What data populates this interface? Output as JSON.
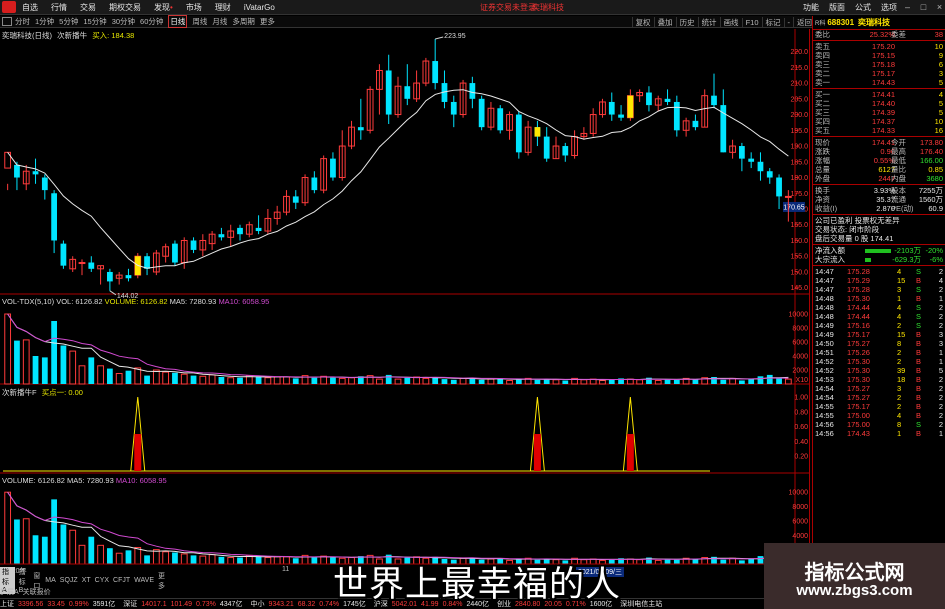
{
  "menu": [
    "自选",
    "行情",
    "交易",
    "期权交易",
    "发现",
    "市场",
    "理财",
    "iVatarGo"
  ],
  "notices": [
    "证券交易未登录",
    "奕瑞科技"
  ],
  "titlebar_right": [
    "功能",
    "版面",
    "公式",
    "选项"
  ],
  "periods": [
    "分时",
    "1分钟",
    "5分钟",
    "15分钟",
    "30分钟",
    "60分钟",
    "日线",
    "周线",
    "月线",
    "多周期",
    "更多"
  ],
  "active_period": "日线",
  "tools": [
    "复权",
    "叠加",
    "历史",
    "统计",
    "画线",
    "F10",
    "标记",
    "-",
    "返回"
  ],
  "main_info": {
    "stock_label": "奕瑞科技(日线)",
    "indicator": "次新播牛",
    "buy_label": "买入: 184.38"
  },
  "price_axis": [
    "220.0",
    "215.0",
    "210.0",
    "205.0",
    "200.0",
    "195.0",
    "190.0",
    "185.0",
    "180.0",
    "175.0",
    "170.0",
    "165.0",
    "160.0",
    "155.0",
    "150.0",
    "145.0"
  ],
  "price_marker": "170.65",
  "high_label": "223.95",
  "low_label": "144.02",
  "vol_info": {
    "name": "VOL-TDX(5,10)",
    "vol": "VOL: 6126.82",
    "volume": "VOLUME: 6126.82",
    "ma5": "MA5: 7280.93",
    "ma10": "MA10: 6058.95"
  },
  "vol_axis": [
    "10000",
    "8000",
    "6000",
    "4000",
    "2000",
    "X10"
  ],
  "signal_info": {
    "name": "次新播牛F",
    "buy": "买点一: 0.00"
  },
  "signal_axis": [
    "1.00",
    "0.80",
    "0.60",
    "0.40",
    "0.20"
  ],
  "vol2_info": {
    "volume": "VOLUME: 6126.82",
    "ma5": "MA5: 7280.93",
    "ma10": "MA10: 6058.95"
  },
  "vol2_axis": [
    "10000",
    "8000",
    "6000",
    "4000",
    "2000"
  ],
  "date_labels": {
    "left": "2020年",
    "mid": "11",
    "highlight": "2021/02/09/三"
  },
  "tabs": [
    "指标A",
    "指标B",
    "窗口",
    "MA",
    "SQJZ",
    "XT",
    "CYX",
    "CFJT",
    "WAVE",
    "更多"
  ],
  "tabs2": [
    "扩展A",
    "关联报价"
  ],
  "quote": {
    "tag": "R科",
    "code": "688301",
    "name": "奕瑞科技",
    "wb_label": "委比",
    "wb_value": "25.32%",
    "wc_label": "委差",
    "wc_value": "38",
    "sells": [
      {
        "label": "卖五",
        "price": "175.20",
        "vol": "10"
      },
      {
        "label": "卖四",
        "price": "175.15",
        "vol": "9"
      },
      {
        "label": "卖三",
        "price": "175.18",
        "vol": "6"
      },
      {
        "label": "卖二",
        "price": "175.17",
        "vol": "3"
      },
      {
        "label": "卖一",
        "price": "174.43",
        "vol": "5"
      }
    ],
    "buys": [
      {
        "label": "买一",
        "price": "174.41",
        "vol": "4"
      },
      {
        "label": "买二",
        "price": "174.40",
        "vol": "5"
      },
      {
        "label": "买三",
        "price": "174.39",
        "vol": "5"
      },
      {
        "label": "买四",
        "price": "174.37",
        "vol": "10"
      },
      {
        "label": "买五",
        "price": "174.33",
        "vol": "16"
      }
    ],
    "stats": [
      {
        "l": "现价",
        "v": "174.41",
        "vc": "red",
        "l2": "今开",
        "v2": "173.80",
        "v2c": "red"
      },
      {
        "l": "涨跌",
        "v": "0.96",
        "vc": "red",
        "l2": "最高",
        "v2": "176.40",
        "v2c": "red"
      },
      {
        "l": "涨幅",
        "v": "0.55%",
        "vc": "red",
        "l2": "最低",
        "v2": "166.00",
        "v2c": "green"
      },
      {
        "l": "总量",
        "v": "6127",
        "vc": "yellow",
        "l2": "量比",
        "v2": "0.85",
        "v2c": "yellow"
      },
      {
        "l": "外盘",
        "v": "2447",
        "vc": "red",
        "l2": "内盘",
        "v2": "3680",
        "v2c": "green"
      }
    ],
    "stats2": [
      {
        "l": "换手",
        "v": "3.93%",
        "l2": "股本",
        "v2": "7255万"
      },
      {
        "l": "净资",
        "v": "35.37",
        "l2": "流通",
        "v2": "1560万"
      },
      {
        "l": "收益(I)",
        "v": "2.870",
        "l2": "PE(动)",
        "v2": "60.9"
      }
    ],
    "notes": [
      "公司已盈利 投票权无差异",
      "交易状态: 闭市阶段",
      "盘后交易量 0 股 174.41"
    ],
    "flows": [
      {
        "l": "净流入额",
        "v": "-2103万",
        "p": "-20%"
      },
      {
        "l": "大宗流入",
        "v": "-629.3万",
        "p": "-6%"
      }
    ],
    "ticks": [
      {
        "t": "14:47",
        "p": "175.28",
        "q": "4",
        "s": "S",
        "sc": "green",
        "c": "2"
      },
      {
        "t": "14:47",
        "p": "175.29",
        "q": "15",
        "s": "B",
        "sc": "red",
        "c": "4"
      },
      {
        "t": "14:47",
        "p": "175.28",
        "q": "3",
        "s": "S",
        "sc": "green",
        "c": "2"
      },
      {
        "t": "14:48",
        "p": "175.30",
        "q": "1",
        "s": "B",
        "sc": "red",
        "c": "1"
      },
      {
        "t": "14:48",
        "p": "174.44",
        "q": "4",
        "s": "S",
        "sc": "green",
        "c": "2"
      },
      {
        "t": "14:48",
        "p": "174.44",
        "q": "4",
        "s": "S",
        "sc": "green",
        "c": "2"
      },
      {
        "t": "14:49",
        "p": "175.16",
        "q": "2",
        "s": "S",
        "sc": "green",
        "c": "2"
      },
      {
        "t": "14:49",
        "p": "175.17",
        "q": "15",
        "s": "B",
        "sc": "red",
        "c": "3"
      },
      {
        "t": "14:50",
        "p": "175.27",
        "q": "8",
        "s": "B",
        "sc": "red",
        "c": "3"
      },
      {
        "t": "14:51",
        "p": "175.26",
        "q": "2",
        "s": "B",
        "sc": "red",
        "c": "1"
      },
      {
        "t": "14:52",
        "p": "175.30",
        "q": "2",
        "s": "B",
        "sc": "red",
        "c": "1"
      },
      {
        "t": "14:52",
        "p": "175.30",
        "q": "39",
        "s": "B",
        "sc": "red",
        "c": "5"
      },
      {
        "t": "14:53",
        "p": "175.30",
        "q": "18",
        "s": "B",
        "sc": "red",
        "c": "2"
      },
      {
        "t": "14:54",
        "p": "175.27",
        "q": "3",
        "s": "B",
        "sc": "red",
        "c": "2"
      },
      {
        "t": "14:54",
        "p": "175.27",
        "q": "2",
        "s": "B",
        "sc": "red",
        "c": "2"
      },
      {
        "t": "14:55",
        "p": "175.17",
        "q": "2",
        "s": "B",
        "sc": "red",
        "c": "2"
      },
      {
        "t": "14:55",
        "p": "175.00",
        "q": "4",
        "s": "B",
        "sc": "red",
        "c": "2"
      },
      {
        "t": "14:56",
        "p": "175.00",
        "q": "8",
        "s": "S",
        "sc": "green",
        "c": "2"
      },
      {
        "t": "14:56",
        "p": "174.43",
        "q": "1",
        "s": "B",
        "sc": "red",
        "c": "1"
      }
    ]
  },
  "indexbar": [
    {
      "n": "上证",
      "v": "3396.56",
      "c": "33.45",
      "p": "0.99%",
      "a": "3591亿"
    },
    {
      "n": "深证",
      "v": "14017.1",
      "c": "101.49",
      "p": "0.73%",
      "a": "4347亿"
    },
    {
      "n": "中小",
      "v": "9343.21",
      "c": "68.32",
      "p": "0.74%",
      "a": "1745亿"
    },
    {
      "n": "沪深",
      "v": "5042.01",
      "c": "41.99",
      "p": "0.84%",
      "a": "2440亿"
    },
    {
      "n": "创业",
      "v": "2840.80",
      "c": "20.05",
      "p": "0.71%",
      "a": "1600亿"
    }
  ],
  "indexbar_tail": "深圳电信主站",
  "overlay": {
    "subtitle": "世界上最幸福的人",
    "brand_cn": "指标公式网",
    "brand_url": "www.zbgs3.com"
  },
  "chart_data": {
    "type": "candlestick",
    "ylim": [
      143,
      224
    ],
    "candles": [
      [
        183,
        188,
        178,
        176
      ],
      [
        184,
        180,
        185,
        176
      ],
      [
        178,
        182,
        184,
        176
      ],
      [
        182,
        181,
        186,
        178
      ],
      [
        180,
        176,
        181,
        173
      ],
      [
        175,
        160,
        176,
        156
      ],
      [
        159,
        152,
        160,
        151
      ],
      [
        151,
        154,
        155,
        150
      ],
      [
        153,
        153,
        154,
        149
      ],
      [
        153,
        151,
        155,
        150
      ],
      [
        151,
        152,
        152,
        146
      ],
      [
        150,
        147,
        151,
        144
      ],
      [
        148,
        149,
        150,
        146
      ],
      [
        149,
        148,
        151,
        147
      ],
      [
        149,
        155,
        156,
        148
      ],
      [
        155,
        151,
        156,
        149
      ],
      [
        150,
        156,
        157,
        149
      ],
      [
        155,
        158,
        159,
        153
      ],
      [
        159,
        153,
        160,
        152
      ],
      [
        153,
        160,
        161,
        151
      ],
      [
        160,
        157,
        161,
        156
      ],
      [
        157,
        160,
        162,
        155
      ],
      [
        159,
        162,
        163,
        157
      ],
      [
        162,
        161,
        164,
        160
      ],
      [
        161,
        163,
        165,
        158
      ],
      [
        164,
        162,
        165,
        160
      ],
      [
        162,
        165,
        166,
        161
      ],
      [
        164,
        163,
        168,
        162
      ],
      [
        163,
        167,
        170,
        162
      ],
      [
        167,
        169,
        171,
        165
      ],
      [
        169,
        174,
        176,
        168
      ],
      [
        174,
        172,
        176,
        170
      ],
      [
        172,
        180,
        181,
        171
      ],
      [
        180,
        176,
        182,
        175
      ],
      [
        176,
        186,
        187,
        175
      ],
      [
        186,
        180,
        188,
        179
      ],
      [
        180,
        190,
        195,
        179
      ],
      [
        190,
        196,
        198,
        189
      ],
      [
        196,
        195,
        205,
        192
      ],
      [
        195,
        208,
        209,
        194
      ],
      [
        208,
        214,
        216,
        200
      ],
      [
        214,
        200,
        219,
        197
      ],
      [
        200,
        209,
        212,
        199
      ],
      [
        209,
        205,
        216,
        203
      ],
      [
        205,
        210,
        214,
        204
      ],
      [
        210,
        217,
        218,
        209
      ],
      [
        217,
        210,
        224,
        208
      ],
      [
        210,
        204,
        214,
        202
      ],
      [
        204,
        200,
        206,
        196
      ],
      [
        200,
        210,
        211,
        199
      ],
      [
        210,
        205,
        212,
        202
      ],
      [
        205,
        196,
        206,
        195
      ],
      [
        196,
        202,
        204,
        195
      ],
      [
        202,
        195,
        203,
        194
      ],
      [
        195,
        200,
        201,
        192
      ],
      [
        200,
        188,
        201,
        186
      ],
      [
        188,
        196,
        198,
        187
      ],
      [
        196,
        193,
        198,
        190
      ],
      [
        193,
        186,
        196,
        185
      ],
      [
        186,
        190,
        193,
        186
      ],
      [
        190,
        187,
        191,
        185
      ],
      [
        187,
        193,
        195,
        186
      ],
      [
        193,
        194,
        196,
        192
      ],
      [
        194,
        200,
        202,
        193
      ],
      [
        200,
        204,
        205,
        199
      ],
      [
        204,
        200,
        207,
        198
      ],
      [
        200,
        199,
        203,
        198
      ],
      [
        199,
        206,
        208,
        198
      ],
      [
        206,
        207,
        208,
        204
      ],
      [
        207,
        203,
        209,
        201
      ],
      [
        203,
        205,
        206,
        201
      ],
      [
        205,
        204,
        208,
        203
      ],
      [
        204,
        195,
        206,
        193
      ],
      [
        195,
        198,
        199,
        193
      ],
      [
        198,
        196,
        200,
        195
      ],
      [
        196,
        206,
        208,
        196
      ],
      [
        206,
        203,
        213,
        202
      ],
      [
        203,
        188,
        208,
        188
      ],
      [
        188,
        190,
        192,
        186
      ],
      [
        190,
        186,
        191,
        182
      ],
      [
        186,
        185,
        188,
        183
      ],
      [
        185,
        182,
        188,
        179
      ],
      [
        182,
        180,
        183,
        178
      ],
      [
        180,
        174,
        181,
        170
      ],
      [
        174,
        174,
        176,
        166
      ]
    ],
    "vol": [
      10000,
      6200,
      6300,
      4000,
      3800,
      9000,
      5500,
      4700,
      2600,
      3800,
      2600,
      2200,
      1500,
      1900,
      2300,
      1200,
      2000,
      1700,
      1600,
      1400,
      1200,
      1100,
      1300,
      1000,
      900,
      900,
      1200,
      1100,
      900,
      1000,
      1000,
      800,
      1200,
      900,
      1100,
      900,
      800,
      900,
      1100,
      1200,
      700,
      1300,
      700,
      900,
      1000,
      800,
      1000,
      700,
      600,
      800,
      900,
      600,
      700,
      800,
      500,
      700,
      800,
      600,
      700,
      600,
      500,
      800,
      600,
      700,
      500,
      600,
      800,
      700,
      600,
      900,
      500,
      700,
      600,
      800,
      700,
      900,
      1000,
      600,
      800,
      500,
      700,
      1100,
      1300,
      900,
      700
    ],
    "signals": [
      14,
      57,
      67
    ]
  }
}
